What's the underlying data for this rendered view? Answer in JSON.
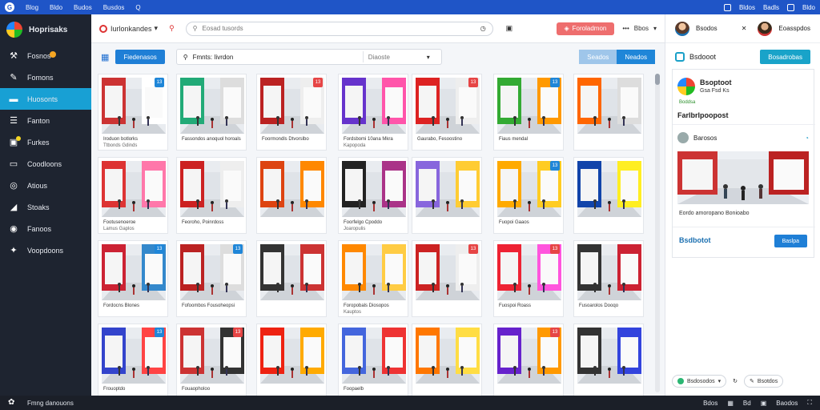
{
  "topbar": {
    "logo": "G",
    "items": [
      "Blog",
      "Bldo",
      "Budos",
      "Busdos",
      "Q"
    ],
    "right": [
      "Bldos",
      "Badls",
      "Bldo"
    ]
  },
  "sidebar": {
    "brand": "Hoprisaks",
    "items": [
      {
        "label": "Fosnos",
        "icon": "hammer-icon"
      },
      {
        "label": "Fomons",
        "icon": "wrench-icon"
      },
      {
        "label": "Huosonts",
        "icon": "store-icon",
        "active": true
      },
      {
        "label": "Fanton",
        "icon": "list-icon"
      },
      {
        "label": "Furkes",
        "icon": "box-icon"
      },
      {
        "label": "Coodloons",
        "icon": "monitor-icon"
      },
      {
        "label": "Atious",
        "icon": "target-icon"
      },
      {
        "label": "Stoaks",
        "icon": "chart-icon"
      },
      {
        "label": "Fanoos",
        "icon": "globe-icon"
      },
      {
        "label": "Voopdoons",
        "icon": "tool-icon"
      }
    ]
  },
  "header": {
    "location": "Iurlonkandes",
    "search_placeholder": "Eosad tusords",
    "red_button": "Foroladmon",
    "more": "Bbos"
  },
  "toolbar": {
    "filter_button": "Fiedenasos",
    "search_label": "Fmnts: Iivrdon",
    "dropdown": "Diaoste",
    "seg1": "Seados",
    "seg2": "Neados"
  },
  "gallery": {
    "cards": [
      {
        "cap": "Iroduon botlorks",
        "cap2": "Ttbonds Gdinds",
        "badge": "13",
        "badgeColor": "#1f86d8"
      },
      {
        "cap": "Fassondos anoquol horoals",
        "cap2": "",
        "badge": "",
        "badgeColor": ""
      },
      {
        "cap": "Foormondls Dtvorslbo",
        "cap2": "",
        "badge": "13",
        "badgeColor": "#e64545"
      },
      {
        "cap": "Fordsbomi 10ana Mkra",
        "cap2": "Kapopoda",
        "badge": "",
        "badgeColor": ""
      },
      {
        "cap": "Gaurabo, Fesoostino",
        "cap2": "",
        "badge": "13",
        "badgeColor": "#e64545"
      },
      {
        "cap": "Fiaus mendal",
        "cap2": "",
        "badge": "13",
        "badgeColor": "#1f86d8"
      },
      {
        "cap": "",
        "cap2": "",
        "badge": "",
        "badgeColor": ""
      },
      {
        "cap": "Footusenoeroe",
        "cap2": "Lamus Gaplos",
        "badge": "",
        "badgeColor": ""
      },
      {
        "cap": "Feoroho, Poinrdoss",
        "cap2": "",
        "badge": "",
        "badgeColor": ""
      },
      {
        "cap": "",
        "cap2": "",
        "badge": "",
        "badgeColor": ""
      },
      {
        "cap": "Foorfelgo Cpoddo",
        "cap2": "Joaropulis",
        "badge": "",
        "badgeColor": ""
      },
      {
        "cap": "",
        "cap2": "",
        "badge": "",
        "badgeColor": ""
      },
      {
        "cap": "Fuopoi Gaaos",
        "cap2": "",
        "badge": "13",
        "badgeColor": "#1f86d8"
      },
      {
        "cap": "",
        "cap2": "",
        "badge": "",
        "badgeColor": ""
      },
      {
        "cap": "Fordocns Blones",
        "cap2": "",
        "badge": "13",
        "badgeColor": "#1f86d8"
      },
      {
        "cap": "Fofoombos Fousoheopsi",
        "cap2": "",
        "badge": "13",
        "badgeColor": "#1f86d8"
      },
      {
        "cap": "",
        "cap2": "",
        "badge": "",
        "badgeColor": ""
      },
      {
        "cap": "Foropobals Diosopos",
        "cap2": "Kauptos",
        "badge": "",
        "badgeColor": ""
      },
      {
        "cap": "",
        "cap2": "",
        "badge": "13",
        "badgeColor": "#e64545"
      },
      {
        "cap": "Fuospoi Roass",
        "cap2": "",
        "badge": "13",
        "badgeColor": "#e64545"
      },
      {
        "cap": "Fusoarolos Dooqo",
        "cap2": "",
        "badge": "",
        "badgeColor": ""
      },
      {
        "cap": "Frouoptdo",
        "cap2": "",
        "badge": "13",
        "badgeColor": "#1f86d8"
      },
      {
        "cap": "Fouaopholoo",
        "cap2": "",
        "badge": "13",
        "badgeColor": "#e64545"
      },
      {
        "cap": "",
        "cap2": "",
        "badge": "",
        "badgeColor": ""
      },
      {
        "cap": "Foopaelb",
        "cap2": "",
        "badge": "",
        "badgeColor": ""
      },
      {
        "cap": "",
        "cap2": "",
        "badge": "",
        "badgeColor": ""
      },
      {
        "cap": "",
        "cap2": "",
        "badge": "13",
        "badgeColor": "#e64545"
      },
      {
        "cap": "",
        "cap2": "",
        "badge": "",
        "badgeColor": ""
      }
    ]
  },
  "rpanel": {
    "head_left": "Bsodos",
    "head_right": "Eoasspdos",
    "section": "Bsdooot",
    "section_button": "Bosadrobas",
    "store_name": "Bsoptoot",
    "store_sub": "Gsa Fsd Ks",
    "store_status": "Boddsa",
    "store_title": "Farlbrlpoopost",
    "poster": "Barosos",
    "photo_caption": "Eordo amoropano Bonioabo",
    "footer_label": "Bsdbotot",
    "footer_button": "Baslpa",
    "bottom_pill": "Bsdosodos",
    "bottom_right": "Bsotdos"
  },
  "bottombar": {
    "text": "Fmng danouons",
    "right": [
      "Bdos",
      "Bd",
      "Baodos"
    ]
  }
}
